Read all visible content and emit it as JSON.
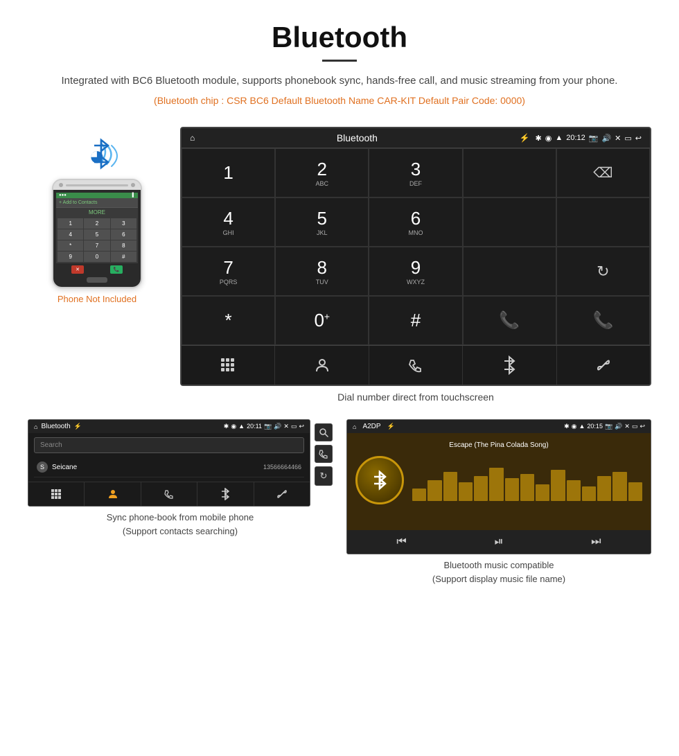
{
  "header": {
    "title": "Bluetooth",
    "description": "Integrated with BC6 Bluetooth module, supports phonebook sync, hands-free call, and music streaming from your phone.",
    "specs": "(Bluetooth chip : CSR BC6    Default Bluetooth Name CAR-KIT    Default Pair Code: 0000)"
  },
  "phone_area": {
    "not_included": "Phone Not Included"
  },
  "main_screen": {
    "status_bar": {
      "title": "Bluetooth",
      "usb_icon": "⚡",
      "time": "20:12"
    },
    "dialpad": {
      "keys": [
        {
          "num": "1",
          "letters": ""
        },
        {
          "num": "2",
          "letters": "ABC"
        },
        {
          "num": "3",
          "letters": "DEF"
        },
        {
          "num": "",
          "letters": ""
        },
        {
          "num": "⌫",
          "letters": ""
        },
        {
          "num": "4",
          "letters": "GHI"
        },
        {
          "num": "5",
          "letters": "JKL"
        },
        {
          "num": "6",
          "letters": "MNO"
        },
        {
          "num": "",
          "letters": ""
        },
        {
          "num": "",
          "letters": ""
        },
        {
          "num": "7",
          "letters": "PQRS"
        },
        {
          "num": "8",
          "letters": "TUV"
        },
        {
          "num": "9",
          "letters": "WXYZ"
        },
        {
          "num": "",
          "letters": ""
        },
        {
          "num": "↻",
          "letters": ""
        },
        {
          "num": "*",
          "letters": ""
        },
        {
          "num": "0",
          "letters": "+"
        },
        {
          "num": "#",
          "letters": ""
        },
        {
          "num": "📞",
          "letters": ""
        },
        {
          "num": "📞",
          "letters": ""
        }
      ]
    },
    "toolbar": {
      "icons": [
        "⠿",
        "👤",
        "📞",
        "✱",
        "🔗"
      ]
    },
    "caption": "Dial number direct from touchscreen"
  },
  "phonebook_screen": {
    "status_bar": {
      "home": "⌂",
      "title": "Bluetooth",
      "time": "20:11"
    },
    "search_placeholder": "Search",
    "contacts": [
      {
        "initial": "S",
        "name": "Seicane",
        "number": "13566664466"
      }
    ],
    "toolbar_icons": [
      "⠿",
      "👤",
      "📞",
      "✱",
      "🔗"
    ],
    "right_icons": [
      "🔍",
      "📞",
      "↻"
    ],
    "caption": "Sync phone-book from mobile phone\n(Support contacts searching)"
  },
  "music_screen": {
    "status_bar": {
      "home": "⌂",
      "title": "A2DP",
      "time": "20:15"
    },
    "song_title": "Escape (The Pina Colada Song)",
    "eq_bars": [
      30,
      50,
      70,
      45,
      60,
      80,
      55,
      65,
      40,
      75,
      50,
      35,
      60,
      70,
      45
    ],
    "controls": [
      "⏮",
      "⏯",
      "⏭"
    ],
    "caption": "Bluetooth music compatible\n(Support display music file name)"
  }
}
